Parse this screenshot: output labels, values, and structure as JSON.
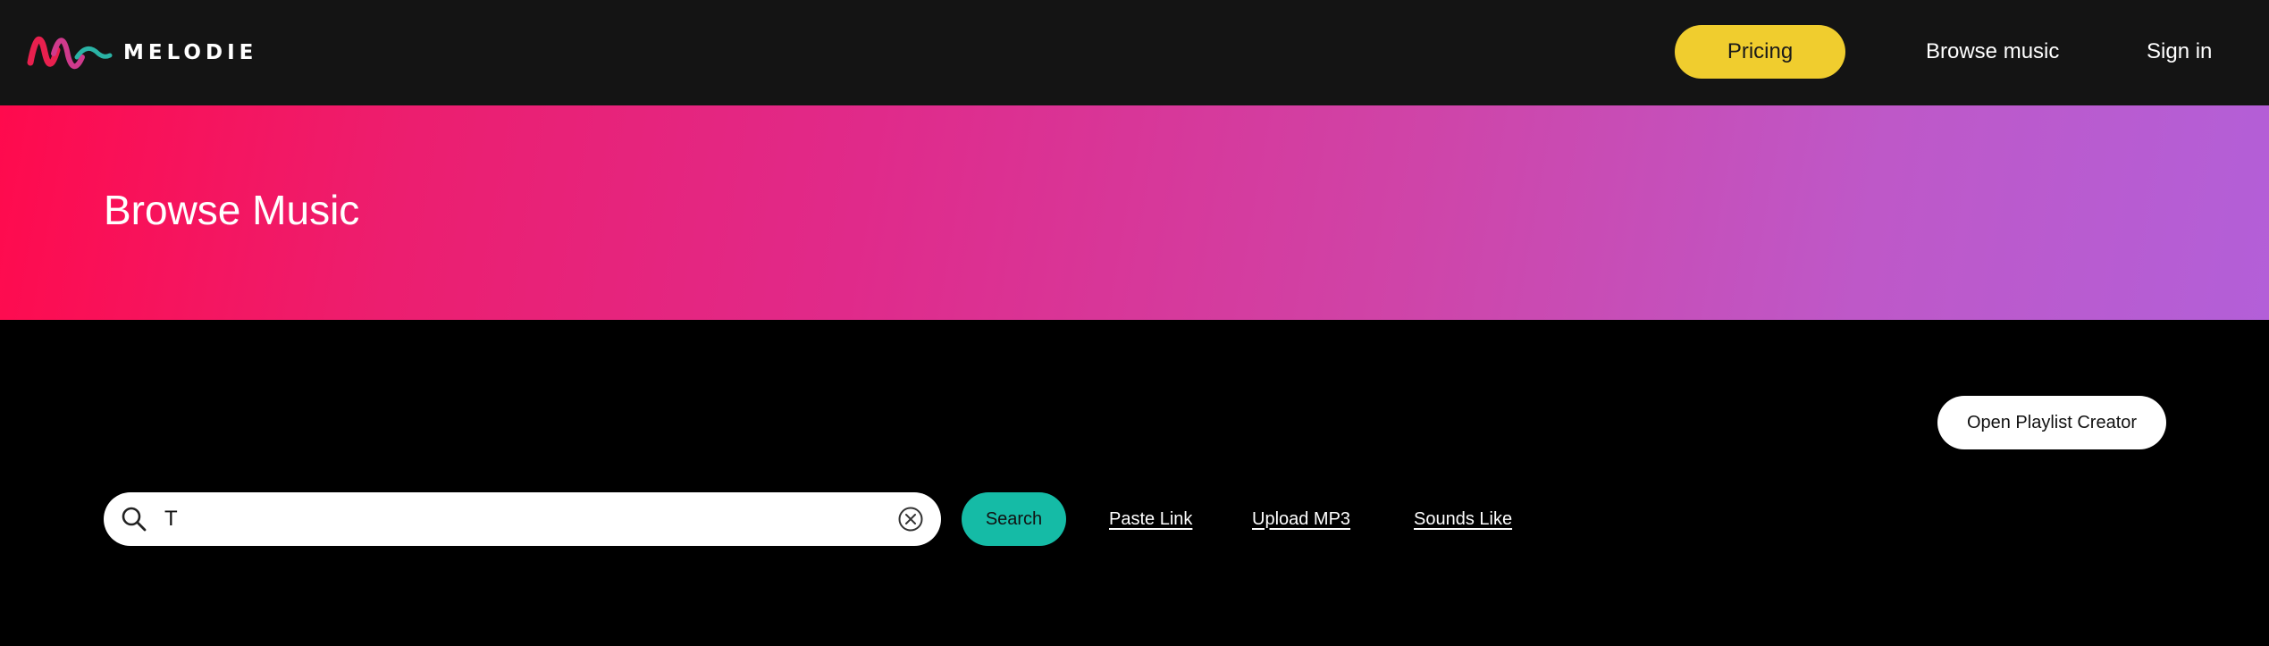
{
  "header": {
    "logo_text": "MELODIE",
    "pricing_label": "Pricing",
    "browse_label": "Browse music",
    "signin_label": "Sign in"
  },
  "hero": {
    "title": "Browse Music"
  },
  "content": {
    "playlist_label": "Open Playlist Creator",
    "search": {
      "value": "T",
      "button_label": "Search"
    },
    "links": {
      "paste_link": "Paste Link",
      "upload_mp3": "Upload MP3",
      "sounds_like": "Sounds Like"
    }
  },
  "colors": {
    "nav_bg": "#141414",
    "pricing_yellow": "#f0cd2e",
    "search_teal": "#15bba6",
    "hero_gradient_start": "#ff0a4d",
    "hero_gradient_end": "#b35fd8"
  },
  "icons": {
    "logo": "wave-logo-icon",
    "search": "search-icon",
    "clear": "clear-circle-x-icon"
  }
}
